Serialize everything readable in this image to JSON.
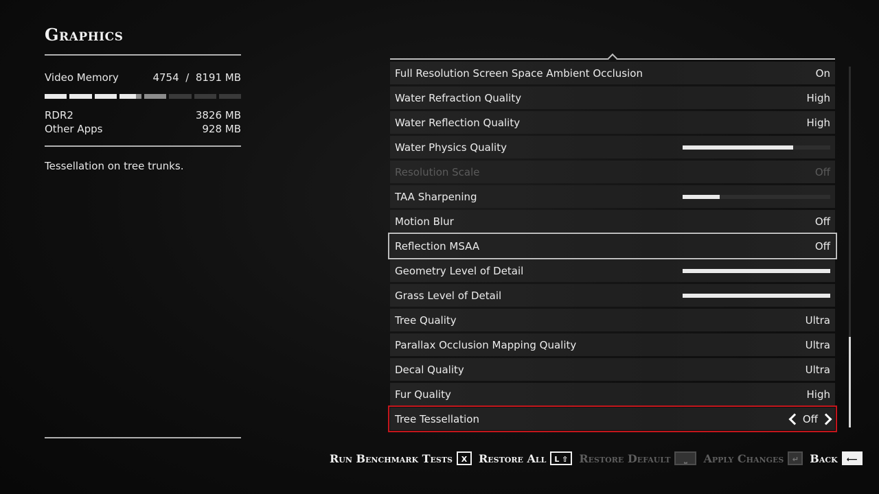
{
  "header": {
    "title": "Graphics"
  },
  "memory": {
    "label": "Video Memory",
    "used": "4754",
    "separator": "/",
    "total": "8191 MB",
    "rdr2_label": "RDR2",
    "rdr2_value": "3826 MB",
    "other_label": "Other Apps",
    "other_value": "928 MB"
  },
  "description": "Tessellation on tree trunks.",
  "settings": [
    {
      "label": "Full Resolution Screen Space Ambient Occlusion",
      "value": "On"
    },
    {
      "label": "Water Refraction Quality",
      "value": "High"
    },
    {
      "label": "Water Reflection Quality",
      "value": "High"
    },
    {
      "label": "Water Physics Quality",
      "slider_fraction": 0.75
    },
    {
      "label": "Resolution Scale",
      "value": "Off",
      "disabled": true
    },
    {
      "label": "TAA Sharpening",
      "slider_fraction": 0.25
    },
    {
      "label": "Motion Blur",
      "value": "Off"
    },
    {
      "label": "Reflection MSAA",
      "value": "Off",
      "selected": true
    },
    {
      "label": "Geometry Level of Detail",
      "slider_fraction": 1.0
    },
    {
      "label": "Grass Level of Detail",
      "slider_fraction": 1.0
    },
    {
      "label": "Tree Quality",
      "value": "Ultra"
    },
    {
      "label": "Parallax Occlusion Mapping Quality",
      "value": "Ultra"
    },
    {
      "label": "Decal Quality",
      "value": "Ultra"
    },
    {
      "label": "Fur Quality",
      "value": "High"
    },
    {
      "label": "Tree Tessellation",
      "value": "Off",
      "active": true
    }
  ],
  "footer": {
    "benchmark": "Run Benchmark Tests",
    "benchmark_key": "X",
    "restore_all": "Restore All",
    "restore_all_key": "L ⇧",
    "restore_default": "Restore Default",
    "restore_default_key": "⎵",
    "apply": "Apply Changes",
    "apply_key": "↵",
    "back": "Back",
    "back_key": "⟵"
  },
  "colors": {
    "accent_red": "#c4161c",
    "selection_grey": "#bdbdbd"
  }
}
